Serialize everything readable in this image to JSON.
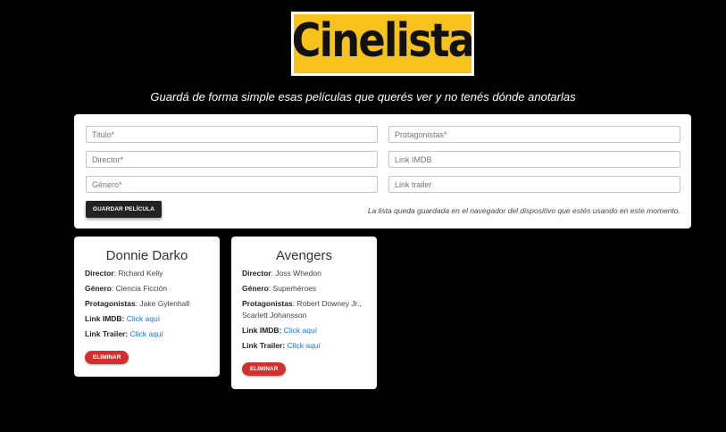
{
  "brand": {
    "logo_text": "Cinelista"
  },
  "tagline": "Guardá de forma simple esas películas que querés ver y no tenés dónde anotarlas",
  "form": {
    "titulo_placeholder": "Titulo*",
    "protagonistas_placeholder": "Protagonistas*",
    "director_placeholder": "Director*",
    "imdb_placeholder": "Link IMDB",
    "genero_placeholder": "Género*",
    "trailer_placeholder": "Link trailer",
    "save_label": "GUARDAR PELÍCULA",
    "note": "La lista queda guardada en el navegador del dispositivo que estés usando en este momento."
  },
  "labels": {
    "director": "Director",
    "genero": "Género",
    "protagonistas": "Protagonistas",
    "imdb": "Link IMDB:",
    "trailer": "Link Trailer:",
    "colon": ": "
  },
  "movies": [
    {
      "title": "Donnie Darko",
      "director": "Richard Kelly",
      "genero": "Ciencia Ficción",
      "protagonistas": "Jake Gylenhall",
      "imdb_link": "Click aquí",
      "trailer_link": "Click aquí",
      "delete_label": "ELIMINAR"
    },
    {
      "title": "Avengers",
      "director": "Joss Whedon",
      "genero": "Superhéroes",
      "protagonistas": "Robert Downey Jr., Scarlett Johansson",
      "imdb_link": "Click aquí",
      "trailer_link": "Click aquí",
      "delete_label": "ELIMINAR"
    }
  ],
  "colors": {
    "background": "#000000",
    "logo_yellow": "#f6c21b",
    "save_button": "#222222",
    "delete_button": "#d32f2f",
    "link": "#1e73d2"
  }
}
